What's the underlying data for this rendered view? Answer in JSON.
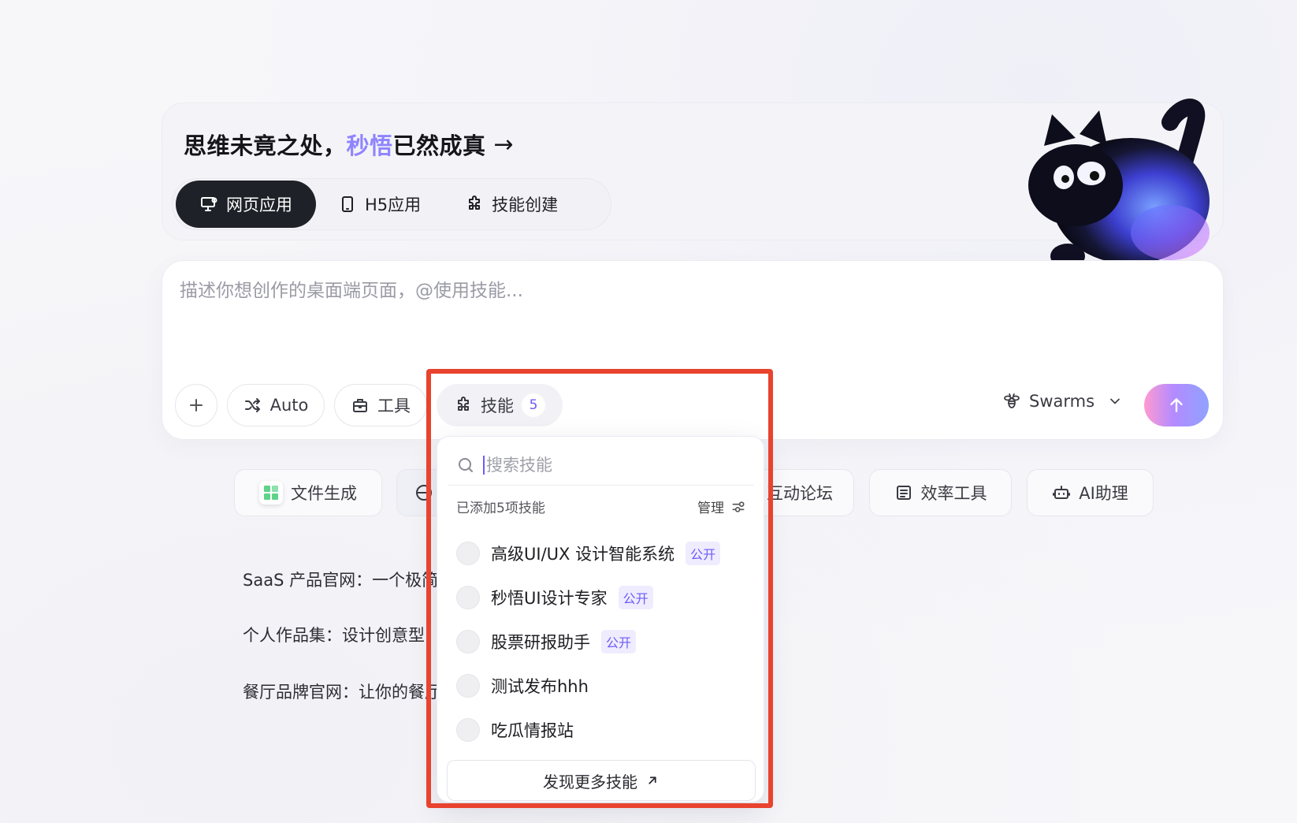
{
  "hero": {
    "tagline_pre": "思维未竟之处，",
    "tagline_accent": "秒悟",
    "tagline_post": "已然成真",
    "tagline_arrow": "→"
  },
  "mode_tabs": [
    {
      "label": "网页应用",
      "icon": "monitor-icon",
      "active": true
    },
    {
      "label": "H5应用",
      "icon": "phone-icon",
      "active": false
    },
    {
      "label": "技能创建",
      "icon": "puzzle-icon",
      "active": false
    }
  ],
  "composer": {
    "placeholder": "描述你想创作的桌面端页面，@使用技能...",
    "auto_label": "Auto",
    "tools_label": "工具",
    "skills_label": "技能",
    "skills_count": "5",
    "swarms_label": "Swarms"
  },
  "categories": {
    "file": "文件生成",
    "forum": "互动论坛",
    "efficiency": "效率工具",
    "ai": "AI助理"
  },
  "examples": [
    "SaaS 产品官网：一个极简",
    "个人作品集：设计创意型",
    "餐厅品牌官网：让你的餐厅"
  ],
  "skills_dropdown": {
    "search_placeholder": "搜索技能",
    "added_label": "已添加5项技能",
    "manage_label": "管理",
    "public_badge": "公开",
    "items": [
      {
        "name": "高级UI/UX 设计智能系统",
        "public": true
      },
      {
        "name": "秒悟UI设计专家",
        "public": true
      },
      {
        "name": "股票研报助手",
        "public": true
      },
      {
        "name": "测试发布hhh",
        "public": false
      },
      {
        "name": "吃瓜情报站",
        "public": false
      }
    ],
    "discover_label": "发现更多技能"
  },
  "colors": {
    "accent": "#8f84ff",
    "brand_purple": "#6d5cf7",
    "highlight_border": "#e8432e",
    "dark_tab": "#1e2127"
  }
}
